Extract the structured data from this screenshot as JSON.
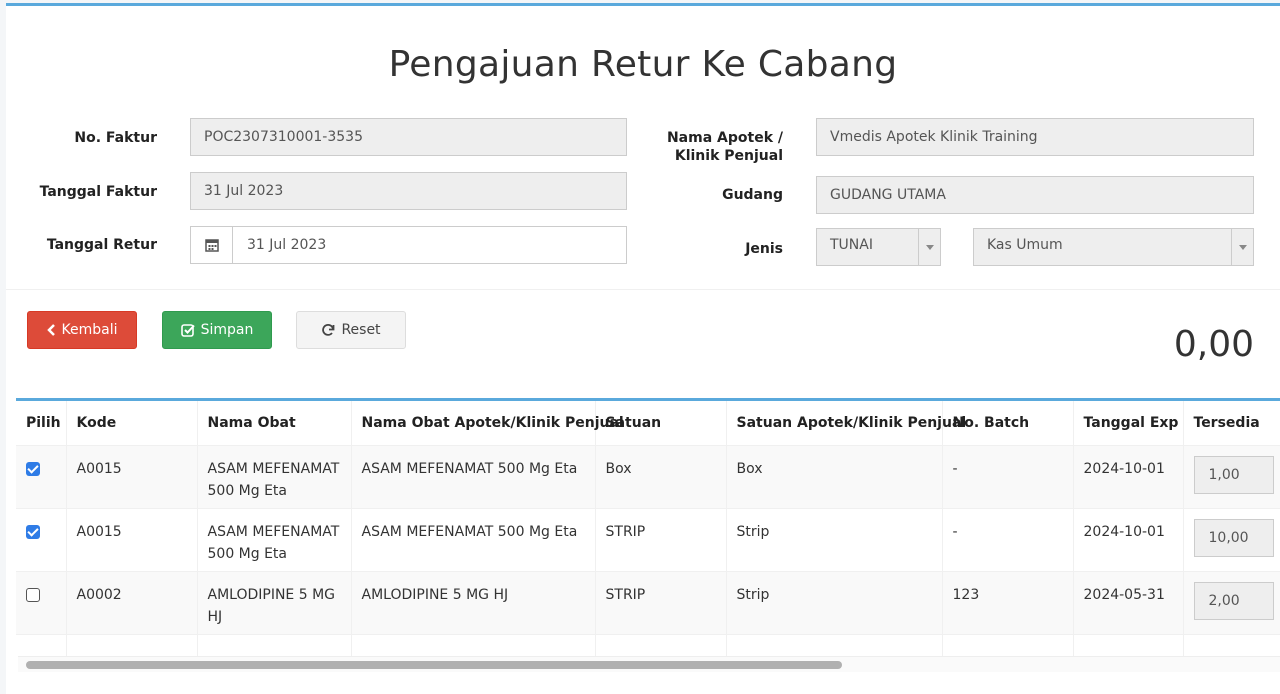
{
  "page": {
    "title": "Pengajuan Retur Ke Cabang"
  },
  "form": {
    "no_faktur_label": "No. Faktur",
    "no_faktur_value": "POC2307310001-3535",
    "tanggal_faktur_label": "Tanggal Faktur",
    "tanggal_faktur_value": "31 Jul 2023",
    "tanggal_retur_label": "Tanggal Retur",
    "tanggal_retur_value": "31 Jul 2023",
    "nama_apotek_label_1": "Nama Apotek /",
    "nama_apotek_label_2": "Klinik Penjual",
    "nama_apotek_value": "Vmedis Apotek Klinik Training",
    "gudang_label": "Gudang",
    "gudang_value": "GUDANG UTAMA",
    "jenis_label": "Jenis",
    "jenis_value": "TUNAI",
    "kas_value": "Kas Umum"
  },
  "buttons": {
    "kembali": "Kembali",
    "simpan": "Simpan",
    "reset": "Reset"
  },
  "total": "0,00",
  "table": {
    "headers": [
      "Pilih",
      "Kode",
      "Nama Obat",
      "Nama Obat Apotek/Klinik Penjual",
      "Satuan",
      "Satuan Apotek/Klinik Penjual",
      "No. Batch",
      "Tanggal Exp",
      "Tersedia"
    ],
    "rows": [
      {
        "checked": true,
        "kode": "A0015",
        "nama": "ASAM MEFENAMAT 500 Mg Eta",
        "nama_penjual": "ASAM MEFENAMAT 500 Mg Eta",
        "satuan": "Box",
        "satuan_penjual": "Box",
        "batch": "-",
        "exp": "2024-10-01",
        "tersedia": "1,00"
      },
      {
        "checked": true,
        "kode": "A0015",
        "nama": "ASAM MEFENAMAT 500 Mg Eta",
        "nama_penjual": "ASAM MEFENAMAT 500 Mg Eta",
        "satuan": "STRIP",
        "satuan_penjual": "Strip",
        "batch": "-",
        "exp": "2024-10-01",
        "tersedia": "10,00"
      },
      {
        "checked": false,
        "kode": "A0002",
        "nama": "AMLODIPINE 5 MG HJ",
        "nama_penjual": "AMLODIPINE 5 MG HJ",
        "satuan": "STRIP",
        "satuan_penjual": "Strip",
        "batch": "123",
        "exp": "2024-05-31",
        "tersedia": "2,00"
      }
    ]
  },
  "colors": {
    "accent": "#5aa9dc",
    "danger": "#dd4b39",
    "success": "#3ca65a",
    "checkbox": "#2f7ce6"
  },
  "icons": {
    "back": "chevron-left-icon",
    "save": "check-square-icon",
    "reset": "refresh-icon",
    "calendar": "calendar-icon",
    "caret": "caret-down-icon"
  }
}
